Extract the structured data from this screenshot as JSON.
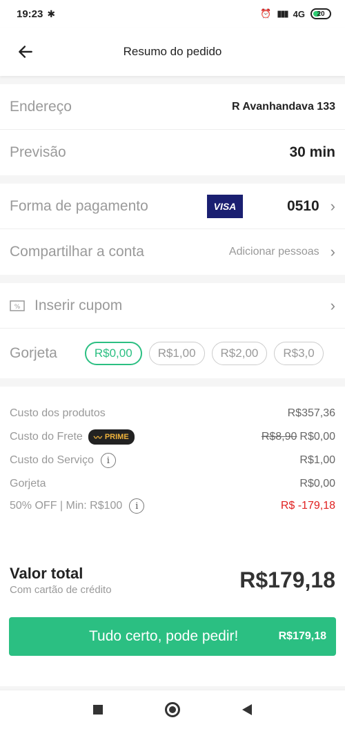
{
  "status": {
    "time": "19:23",
    "network": "4G",
    "battery": "20"
  },
  "header": {
    "title": "Resumo do pedido"
  },
  "delivery": {
    "address_label": "Endereço",
    "address_value": "R Avanhandava 133",
    "eta_label": "Previsão",
    "eta_value": "30 min"
  },
  "payment": {
    "label": "Forma de pagamento",
    "card_brand": "VISA",
    "card_last": "0510",
    "share_label": "Compartilhar a conta",
    "share_action": "Adicionar pessoas"
  },
  "coupon": {
    "label": "Inserir cupom"
  },
  "tip": {
    "label": "Gorjeta",
    "options": [
      "R$0,00",
      "R$1,00",
      "R$2,00",
      "R$3,0"
    ]
  },
  "summary": {
    "products_label": "Custo dos produtos",
    "products_value": "R$357,36",
    "shipping_label": "Custo do Frete",
    "prime_badge": "PRIME",
    "shipping_old": "R$8,90",
    "shipping_value": "R$0,00",
    "service_label": "Custo do Serviço",
    "service_value": "R$1,00",
    "tip_label": "Gorjeta",
    "tip_value": "R$0,00",
    "discount_label": "50% OFF | Min: R$100",
    "discount_value": "R$ -179,18",
    "total_label": "Valor total",
    "total_sub": "Com cartão de crédito",
    "total_value": "R$179,18"
  },
  "cta": {
    "label": "Tudo certo, pode pedir!",
    "value": "R$179,18"
  },
  "colors": {
    "accent": "#2bbf82",
    "visa": "#1a1f71",
    "discount": "#e02020"
  }
}
